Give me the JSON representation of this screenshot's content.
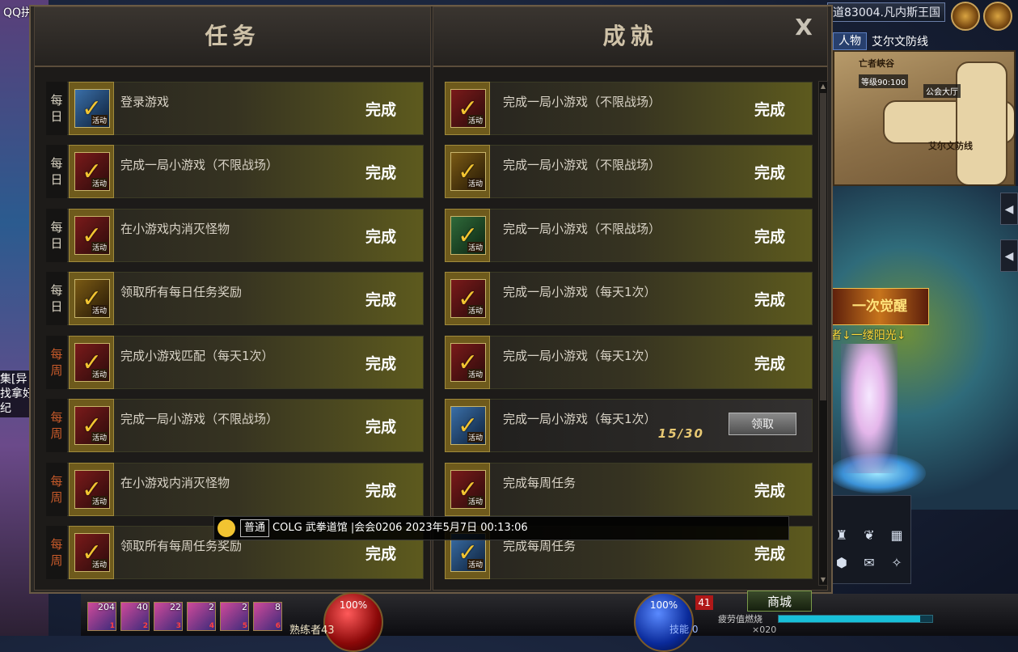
{
  "ime": "QQ拼音输入法",
  "server": "道83004.凡内斯王国",
  "map": {
    "tab_label": "人物",
    "area_name": "艾尔文防线",
    "labels": {
      "canyon": "亡者峡谷",
      "level": "等级90:100",
      "guild": "公会大厅",
      "defense": "艾尔文防线"
    }
  },
  "awaken_banner": "一次觉醒",
  "player_name": "者↓一缕阳光↓",
  "left_chat": [
    "集[异",
    "找拿好",
    "纪"
  ],
  "dialog": {
    "quests_header": "任务",
    "achievements_header": "成就",
    "close_label": "X",
    "activity_tag": "活动",
    "quests": [
      {
        "period": [
          "每",
          "日"
        ],
        "weekly": false,
        "title": "登录游戏",
        "status": "完成",
        "icon": "blue"
      },
      {
        "period": [
          "每",
          "日"
        ],
        "weekly": false,
        "title": "完成一局小游戏（不限战场）",
        "status": "完成",
        "icon": "red"
      },
      {
        "period": [
          "每",
          "日"
        ],
        "weekly": false,
        "title": "在小游戏内消灭怪物",
        "status": "完成",
        "icon": "red"
      },
      {
        "period": [
          "每",
          "日"
        ],
        "weekly": false,
        "title": "领取所有每日任务奖励",
        "status": "完成",
        "icon": "gold"
      },
      {
        "period": [
          "每",
          "周"
        ],
        "weekly": true,
        "title": "完成小游戏匹配（每天1次）",
        "status": "完成",
        "icon": "red"
      },
      {
        "period": [
          "每",
          "周"
        ],
        "weekly": true,
        "title": "完成一局小游戏（不限战场）",
        "status": "完成",
        "icon": "red"
      },
      {
        "period": [
          "每",
          "周"
        ],
        "weekly": true,
        "title": "在小游戏内消灭怪物",
        "status": "完成",
        "icon": "red"
      },
      {
        "period": [
          "每",
          "周"
        ],
        "weekly": true,
        "title": "领取所有每周任务奖励",
        "status": "完成",
        "icon": "red"
      }
    ],
    "achievements": [
      {
        "title": "完成一局小游戏（不限战场）",
        "status": "完成",
        "icon": "red",
        "claim": false
      },
      {
        "title": "完成一局小游戏（不限战场）",
        "status": "完成",
        "icon": "gold",
        "claim": false
      },
      {
        "title": "完成一局小游戏（不限战场）",
        "status": "完成",
        "icon": "green",
        "claim": false
      },
      {
        "title": "完成一局小游戏（每天1次）",
        "status": "完成",
        "icon": "red",
        "claim": false
      },
      {
        "title": "完成一局小游戏（每天1次）",
        "status": "完成",
        "icon": "red",
        "claim": false
      },
      {
        "title": "完成一局小游戏（每天1次）",
        "progress": "15/30",
        "button": "领取",
        "icon": "blue",
        "claim": true
      },
      {
        "title": "完成每周任务",
        "status": "完成",
        "icon": "red",
        "claim": false
      },
      {
        "title": "完成每周任务",
        "status": "完成",
        "icon": "blue",
        "claim": false
      }
    ]
  },
  "chat_message": {
    "channel": "普通",
    "text": "COLG  武拳道馆 |会会0206  2023年5月7日  00:13:06"
  },
  "hud": {
    "slots": [
      {
        "count": "204",
        "key": "1"
      },
      {
        "count": "40",
        "key": "2"
      },
      {
        "count": "22",
        "key": "3"
      },
      {
        "count": "2",
        "key": "4"
      },
      {
        "count": "2",
        "key": "5"
      },
      {
        "count": "8",
        "key": "6"
      }
    ],
    "hp": "100%",
    "mp": "100%",
    "level_text": "熟练者43",
    "skill_label": "技能  0",
    "level_num": "41",
    "shop": "商城",
    "fatigue_label": "疲劳值燃烧",
    "fatigue_ratio": 0.92,
    "xp_text": "×020"
  }
}
